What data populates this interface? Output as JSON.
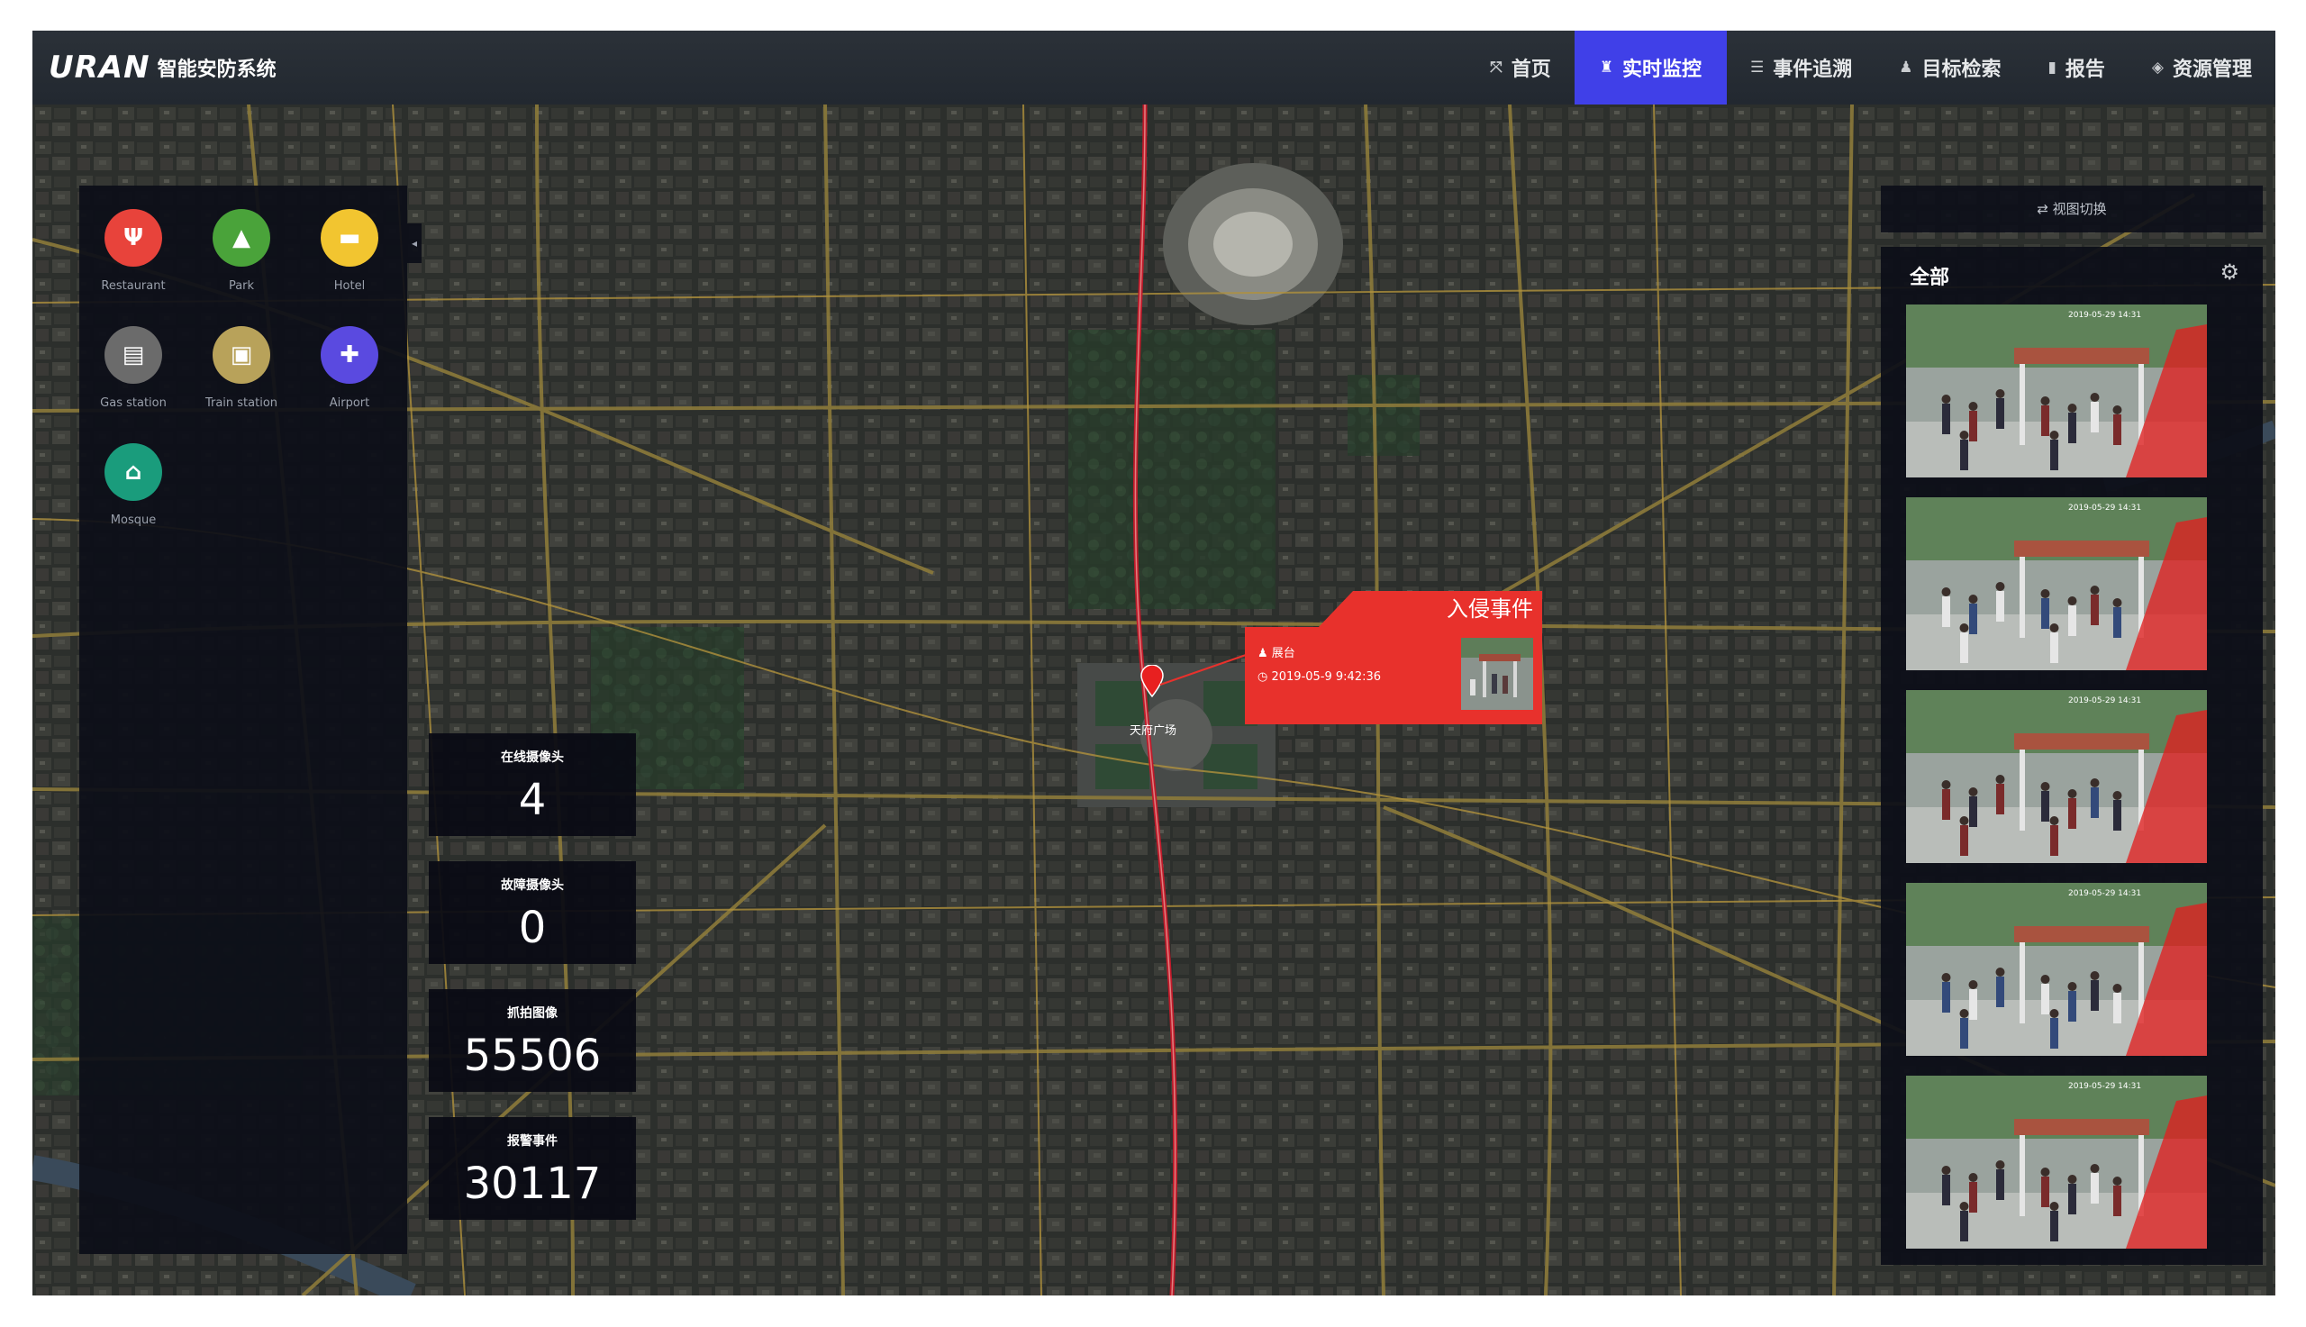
{
  "app": {
    "logo_mark": "URAN",
    "title": "智能安防系统"
  },
  "nav": [
    {
      "label": "首页",
      "icon": "home-icon",
      "active": false
    },
    {
      "label": "实时监控",
      "icon": "monitor-icon",
      "active": true
    },
    {
      "label": "事件追溯",
      "icon": "event-trace-icon",
      "active": false
    },
    {
      "label": "目标检索",
      "icon": "target-search-icon",
      "active": false
    },
    {
      "label": "报告",
      "icon": "report-icon",
      "active": false
    },
    {
      "label": "资源管理",
      "icon": "resource-icon",
      "active": false
    }
  ],
  "poi": [
    {
      "label": "Restaurant",
      "icon": "restaurant-icon",
      "glyph": "🍴",
      "color": "#e8433b"
    },
    {
      "label": "Park",
      "icon": "park-icon",
      "glyph": "▲",
      "color": "#4aa33a"
    },
    {
      "label": "Hotel",
      "icon": "hotel-icon",
      "glyph": "▬",
      "color": "#f2c530"
    },
    {
      "label": "Gas station",
      "icon": "gas-station-icon",
      "glyph": "⛽",
      "color": "#6b6b6b"
    },
    {
      "label": "Train station",
      "icon": "train-station-icon",
      "glyph": "▣",
      "color": "#b8a25a"
    },
    {
      "label": "Airport",
      "icon": "airport-icon",
      "glyph": "✈",
      "color": "#5a4ae0"
    },
    {
      "label": "Mosque",
      "icon": "mosque-icon",
      "glyph": "▲",
      "color": "#1a9c7c"
    }
  ],
  "stats": [
    {
      "label": "在线摄像头",
      "value": "4"
    },
    {
      "label": "故障摄像头",
      "value": "0"
    },
    {
      "label": "抓拍图像",
      "value": "55506"
    },
    {
      "label": "报警事件",
      "value": "30117"
    }
  ],
  "alert": {
    "title": "入侵事件",
    "location": "展台",
    "time": "2019-05-9 9:42:36",
    "color": "#e8312c"
  },
  "map": {
    "marker_label": "天府广场"
  },
  "camera_panel": {
    "view_switch": "视图切换",
    "heading": "全部",
    "feeds": [
      {
        "timestamp": "2019-05-29 14:31"
      },
      {
        "timestamp": "2019-05-29 14:31"
      },
      {
        "timestamp": "2019-05-29 14:31"
      },
      {
        "timestamp": "2019-05-29 14:31"
      },
      {
        "timestamp": "2019-05-29 14:31"
      }
    ]
  },
  "colors": {
    "nav_active": "#4040e8",
    "alert": "#e8312c"
  }
}
